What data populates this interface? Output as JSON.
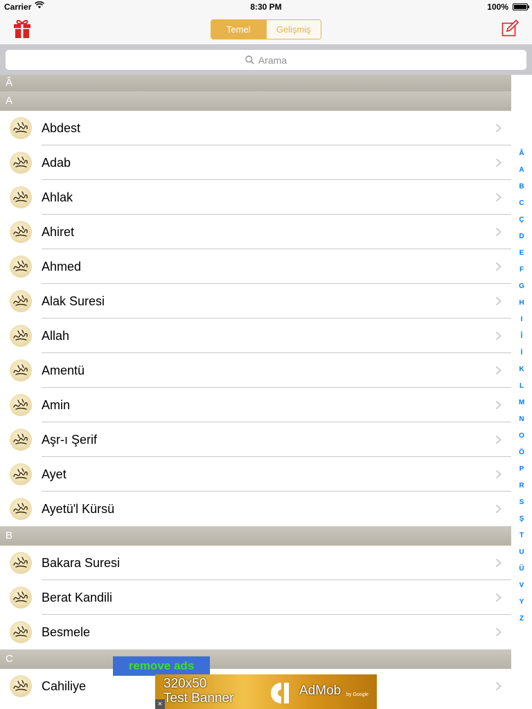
{
  "status_bar": {
    "carrier": "Carrier",
    "time": "8:30 PM",
    "battery": "100%"
  },
  "nav": {
    "segments": [
      {
        "label": "Temel",
        "selected": true
      },
      {
        "label": "Gelişmiş",
        "selected": false
      }
    ],
    "accent_color": "#e8b34b"
  },
  "search": {
    "placeholder": "Arama"
  },
  "sections": [
    {
      "title": "Â",
      "items": []
    },
    {
      "title": "A",
      "items": [
        "Abdest",
        "Adab",
        "Ahlak",
        "Ahiret",
        "Ahmed",
        "Alak Suresi",
        "Allah",
        "Amentü",
        "Amin",
        "Aşr-ı Şerif",
        "Ayet",
        "Ayetü'l Kürsü"
      ]
    },
    {
      "title": "B",
      "items": [
        "Bakara Suresi",
        "Berat Kandili",
        "Besmele"
      ]
    },
    {
      "title": "C",
      "items": [
        "Cahiliye"
      ]
    }
  ],
  "index": [
    "Â",
    "A",
    "B",
    "C",
    "Ç",
    "D",
    "E",
    "F",
    "G",
    "H",
    "I",
    "Î",
    "İ",
    "K",
    "L",
    "M",
    "N",
    "O",
    "Ö",
    "P",
    "R",
    "S",
    "Ş",
    "T",
    "U",
    "Ü",
    "V",
    "Y",
    "Z"
  ],
  "ads": {
    "remove_ads_label": "remove ads",
    "banner_line1": "320x50",
    "banner_line2": "Test Banner",
    "admob_label": "AdMob",
    "admob_by": "by Google",
    "close_symbol": "×"
  },
  "icons": {
    "left_nav": "gift-icon",
    "right_nav": "compose-icon",
    "row_thumb": "calligraphy-icon",
    "row_accessory": "chevron-right-icon"
  }
}
